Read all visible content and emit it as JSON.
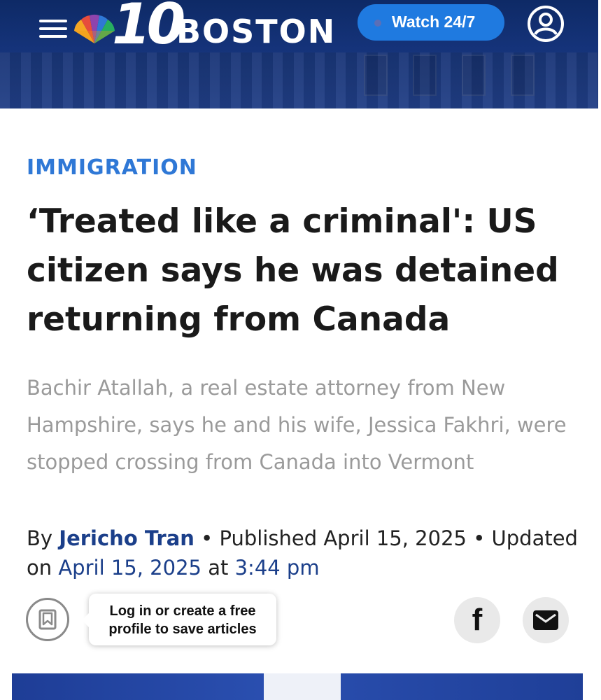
{
  "header": {
    "logo_number": "10",
    "logo_city": "BOSTON",
    "watch_label": "Watch 24/7",
    "colors": {
      "background": "#15337a",
      "watch_button": "#1f7ae0"
    }
  },
  "article": {
    "category": "IMMIGRATION",
    "headline": "‘Treated like a criminal': US citizen says he was detained returning from Canada",
    "subheadline": "Bachir Atallah, a real estate attorney from New Hampshire, says he and his wife, Jessica Fakhri, were stopped crossing from Canada into Vermont",
    "byline": {
      "by": "By",
      "author": "Jericho Tran",
      "separator": "•",
      "published_label": "Published April 15, 2025",
      "updated_label": "Updated on",
      "updated_date": "April 15, 2025",
      "at": "at",
      "updated_time": "3:44 pm"
    },
    "colors": {
      "category": "#2f78d6",
      "byline_link": "#1b3f8a",
      "subheadline": "#9a9a9a"
    }
  },
  "actions": {
    "bookmark_tooltip": "Log in or create a free profile to save articles",
    "share_facebook_glyph": "f",
    "icons": [
      "bookmark-icon",
      "facebook-icon",
      "email-icon"
    ]
  }
}
